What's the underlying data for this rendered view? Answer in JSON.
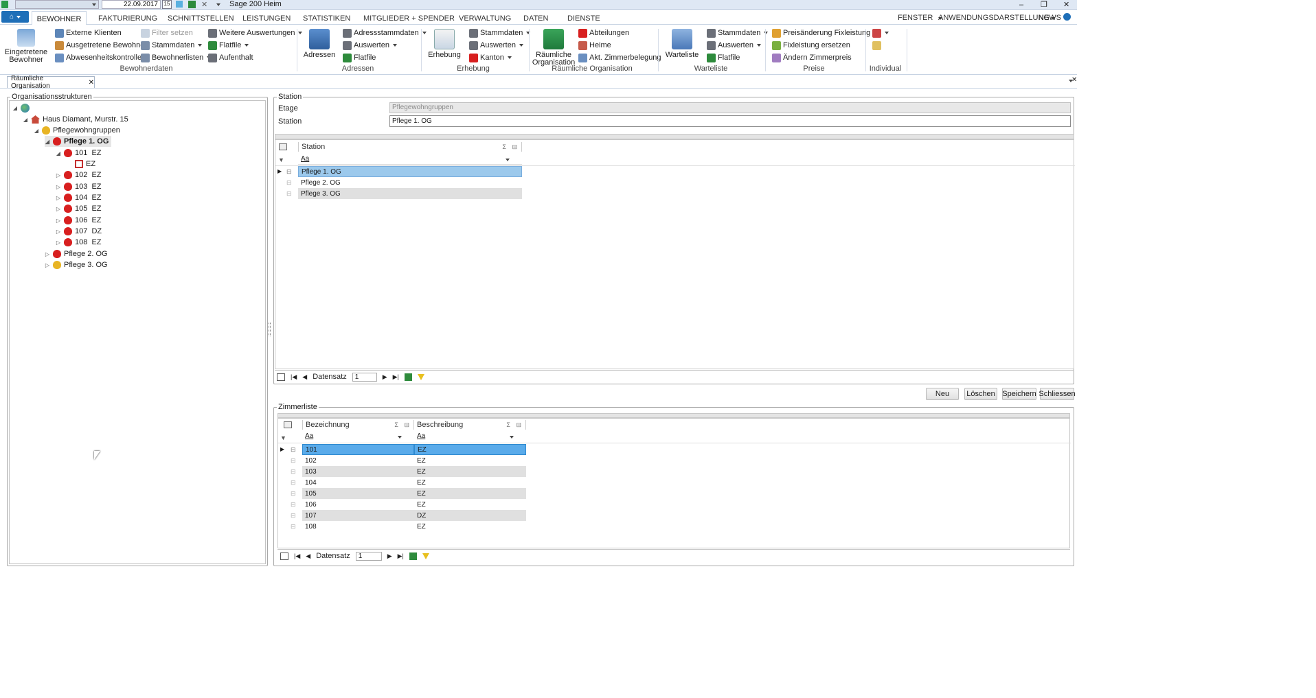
{
  "titlebar": {
    "date": "22.09.2017",
    "date_btn": "15",
    "title": "Sage 200 Heim"
  },
  "menu": {
    "tabs": [
      "BEWOHNER",
      "FAKTURIERUNG",
      "SCHNITTSTELLEN",
      "LEISTUNGEN",
      "STATISTIKEN",
      "MITGLIEDER + SPENDER",
      "VERWALTUNG",
      "DATEN",
      "DIENSTE"
    ],
    "right": [
      "FENSTER",
      "ANWENDUNGSDARSTELLUNG",
      "NEWS"
    ]
  },
  "ribbon": {
    "bewohnerdaten": {
      "label": "Bewohnerdaten",
      "eingetretene": "Eingetretene Bewohner",
      "externe": "Externe Klienten",
      "ausgetretene": "Ausgetretene Bewohner",
      "abwesenheit": "Abwesenheitskontrolle",
      "filter": "Filter setzen",
      "stammdaten": "Stammdaten",
      "bewohnerlisten": "Bewohnerlisten",
      "weitere": "Weitere Auswertungen",
      "flatfile": "Flatfile",
      "aufenthalt": "Aufenthalt"
    },
    "adressen": {
      "label": "Adressen",
      "big": "Adressen",
      "adressstammdaten": "Adressstammdaten",
      "auswerten": "Auswerten",
      "flatfile": "Flatfile"
    },
    "erhebung": {
      "label": "Erhebung",
      "big": "Erhebung",
      "stammdaten": "Stammdaten",
      "auswerten": "Auswerten",
      "kanton": "Kanton"
    },
    "raeumliche": {
      "label": "Räumliche Organisation",
      "big": "Räumliche Organisation",
      "abteilungen": "Abteilungen",
      "heime": "Heime",
      "zimmerbelegung": "Akt. Zimmerbelegung"
    },
    "warteliste": {
      "label": "Warteliste",
      "big": "Warteliste",
      "stammdaten": "Stammdaten",
      "auswerten": "Auswerten",
      "flatfile": "Flatfile"
    },
    "preise": {
      "label": "Preise",
      "preisaenderung": "Preisänderung Fixleistung",
      "fixleistung": "Fixleistung ersetzen",
      "zimmerpreis": "Ändern Zimmerpreis"
    },
    "individual": {
      "label": "Individual"
    }
  },
  "doctab": {
    "label": "Räumliche Organisation"
  },
  "org": {
    "legend": "Organisationsstrukturen",
    "haus": "Haus Diamant, Murstr. 15",
    "pflegewohngruppen": "Pflegewohngruppen",
    "pflege1": "Pflege 1. OG",
    "room101": "101  EZ",
    "ez": "EZ",
    "rooms": [
      "102  EZ",
      "103  EZ",
      "104  EZ",
      "105  EZ",
      "106  EZ",
      "107  DZ",
      "108  EZ"
    ],
    "pflege2": "Pflege 2. OG",
    "pflege3": "Pflege 3. OG"
  },
  "station": {
    "legend": "Station",
    "etage_label": "Etage",
    "etage_value": "Pflegewohngruppen",
    "station_label": "Station",
    "station_value": "Pflege 1. OG",
    "grid": {
      "header": "Station",
      "filter": "Aa",
      "rows": [
        "Pflege 1. OG",
        "Pflege 2. OG",
        "Pflege 3. OG"
      ]
    },
    "nav": {
      "label": "Datensatz",
      "value": "1"
    }
  },
  "buttons": {
    "neu": "Neu",
    "loeschen": "Löschen",
    "speichern": "Speichern",
    "schliessen": "Schliessen"
  },
  "zimmer": {
    "legend": "Zimmerliste",
    "headers": [
      "Bezeichnung",
      "Beschreibung"
    ],
    "filter": "Aa",
    "rows": [
      [
        "101",
        "EZ"
      ],
      [
        "102",
        "EZ"
      ],
      [
        "103",
        "EZ"
      ],
      [
        "104",
        "EZ"
      ],
      [
        "105",
        "EZ"
      ],
      [
        "106",
        "EZ"
      ],
      [
        "107",
        "DZ"
      ],
      [
        "108",
        "EZ"
      ]
    ],
    "nav": {
      "label": "Datensatz",
      "value": "1"
    }
  },
  "colors": {
    "accent": "#1e6fb8",
    "selected": "#7dbef0",
    "ribbon_bg": "#ffffff"
  }
}
